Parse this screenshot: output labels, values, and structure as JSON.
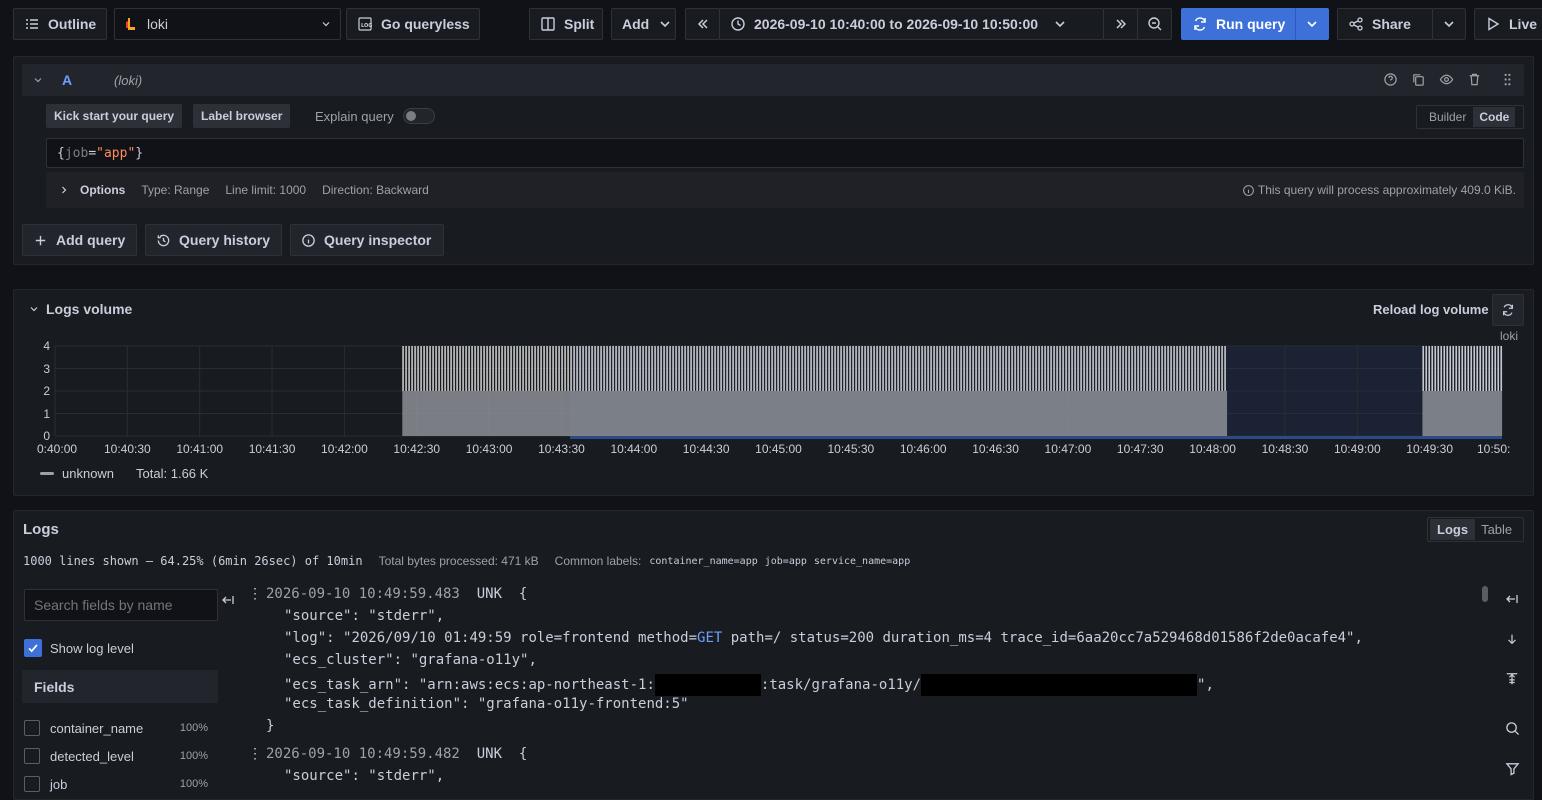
{
  "toolbar": {
    "outline": "Outline",
    "datasource": "loki",
    "go_queryless": "Go queryless",
    "split": "Split",
    "add": "Add",
    "time_range": "2026-09-10 10:40:00 to 2026-09-10 10:50:00",
    "run_query": "Run query",
    "share": "Share",
    "live": "Live"
  },
  "query": {
    "ref_id": "A",
    "datasource_hint": "(loki)",
    "kick_start": "Kick start your query",
    "label_browser": "Label browser",
    "explain_query": "Explain query",
    "mode_builder": "Builder",
    "mode_code": "Code",
    "expr_open": "{",
    "expr_key": "job",
    "expr_eq": "=",
    "expr_val": "\"app\"",
    "expr_close": "}",
    "options_label": "Options",
    "type": "Type: Range",
    "line_limit": "Line limit: 1000",
    "direction": "Direction: Backward",
    "estimate": "This query will process approximately 409.0 KiB.",
    "add_query": "Add query",
    "query_history": "Query history",
    "query_inspector": "Query inspector"
  },
  "volume": {
    "title": "Logs volume",
    "reload": "Reload log volume",
    "series_label": "loki",
    "legend_name": "unknown",
    "legend_total": "Total: 1.66 K"
  },
  "chart_data": {
    "type": "bar",
    "title": "Logs volume",
    "ylim": [
      0,
      4
    ],
    "y_ticks": [
      "0",
      "1",
      "2",
      "3",
      "4"
    ],
    "x_ticks": [
      "0:40:00",
      "10:40:30",
      "10:41:00",
      "10:41:30",
      "10:42:00",
      "10:42:30",
      "10:43:00",
      "10:43:30",
      "10:44:00",
      "10:44:30",
      "10:45:00",
      "10:45:30",
      "10:46:00",
      "10:46:30",
      "10:47:00",
      "10:47:30",
      "10:48:00",
      "10:48:30",
      "10:49:00",
      "10:49:30",
      "10:50:"
    ],
    "series": [
      {
        "name": "unknown",
        "segments": [
          {
            "from": "10:42:24",
            "to": "10:48:06",
            "value": 4
          },
          {
            "from": "10:49:27",
            "to": "10:50:00",
            "value": 4
          }
        ],
        "baseline": 2
      }
    ],
    "grid": true,
    "legend": "bottom-left",
    "color": "#c7c7c7"
  },
  "logs": {
    "title": "Logs",
    "tab_logs": "Logs",
    "tab_table": "Table",
    "summary": "1000 lines shown — 64.25% (6min 26sec) of 10min",
    "bytes": "Total bytes processed: 471 kB",
    "common_labels_title": "Common labels:",
    "common_labels": [
      "container_name=app",
      "job=app",
      "service_name=app"
    ],
    "search_placeholder": "Search fields by name",
    "show_log_level": "Show log level",
    "fields_title": "Fields",
    "fields": [
      {
        "name": "container_name",
        "pct": "100%"
      },
      {
        "name": "detected_level",
        "pct": "100%"
      },
      {
        "name": "job",
        "pct": "100%"
      }
    ],
    "entries": [
      {
        "ts": "2026-09-10 10:49:59.483",
        "level": "UNK",
        "source_key": "\"source\"",
        "source_val": "\"stderr\",",
        "log_key": "\"log\"",
        "log_pre": "\"2026/09/10 01:49:59 role=frontend method=",
        "log_method": "GET",
        "log_post": " path=/ status=200 duration_ms=4 trace_id=6aa20cc7a529468d01586f2de0acafe4\",",
        "cluster_key": "\"ecs_cluster\"",
        "cluster_val": "\"grafana-o11y\",",
        "arn_key": "\"ecs_task_arn\"",
        "arn_a": "\"arn:aws:ecs:ap-northeast-1:",
        "arn_b": ":task/grafana-o11y/",
        "arn_c": "\",",
        "def_key": "\"ecs_task_definition\"",
        "def_val": "\"grafana-o11y-frontend:5\""
      },
      {
        "ts": "2026-09-10 10:49:59.482",
        "level": "UNK",
        "source_key": "\"source\"",
        "source_val": "\"stderr\","
      }
    ]
  }
}
